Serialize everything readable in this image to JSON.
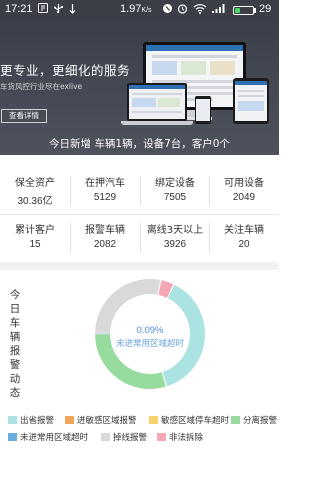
{
  "status_bar": {
    "time": "17:21",
    "network_speed": "1.97",
    "network_speed_unit": "K/s",
    "battery_level": "29",
    "icons": [
      "notification-icon",
      "usb-icon",
      "data-icon",
      "vibrate-icon",
      "alarm-icon",
      "wifi-icon",
      "signal-icon",
      "battery-icon"
    ]
  },
  "banner": {
    "headline": "更专业，更细化的服务",
    "tagline": "车货风控行业尽在exlive",
    "detail_button": "查看详情",
    "today_summary": "今日新增 车辆1辆，设备7台，客户0个"
  },
  "stats": [
    {
      "label": "保全资产",
      "value": "30.36亿"
    },
    {
      "label": "在押汽车",
      "value": "5129"
    },
    {
      "label": "绑定设备",
      "value": "7505"
    },
    {
      "label": "可用设备",
      "value": "2049"
    },
    {
      "label": "累计客户",
      "value": "15"
    },
    {
      "label": "报警车辆",
      "value": "2082"
    },
    {
      "label": "离线3天以上",
      "value": "3926"
    },
    {
      "label": "关注车辆",
      "value": "20"
    }
  ],
  "alarm_section": {
    "title": "今日车辆报警动态",
    "center_percent": "0.09%",
    "center_label": "未进常用区域超时"
  },
  "chart_data": {
    "type": "pie",
    "donut": true,
    "title": "今日车辆报警动态",
    "categories": [
      "出省报警",
      "进敏感区域报警",
      "敏感区域停车超时",
      "分离报警",
      "未进常用区域超时",
      "掉线报警",
      "非法拆除"
    ],
    "values": [
      38,
      0,
      0,
      30,
      0.09,
      28,
      4
    ],
    "colors": [
      "#abe2e2",
      "#f0a55c",
      "#f6d36b",
      "#97dc9e",
      "#6aaedf",
      "#d9d9d9",
      "#f5a7b3"
    ],
    "highlighted": "未进常用区域超时"
  }
}
